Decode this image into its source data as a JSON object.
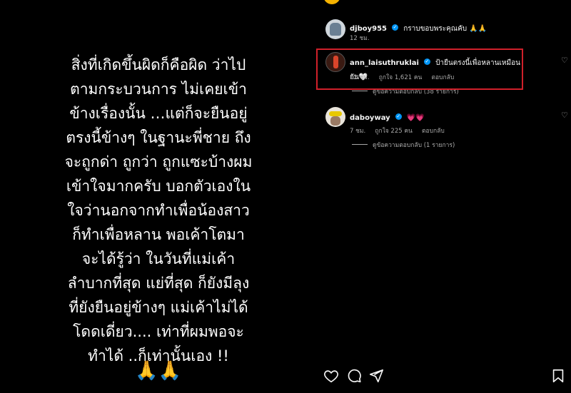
{
  "post": {
    "caption": "สิ่งที่เกิดขึ้นผิดก็คือผิด ว่าไป\nตามกระบวนการ ไม่เคยเข้า\nข้างเรื่องนั้น …แต่ก็จะยืนอยู่\nตรงนี้ข้างๆ ในฐานะพี่ชาย ถึง\nจะถูกด่า ถูกว่า ถูกแซะบ้างผม\nเข้าใจมากครับ บอกตัวเองใน\nใจว่านอกจากทำเพื่อน้องสาว\nก็ทำเพื่อหลาน พอเค้าโตมา\nจะได้รู้ว่า ในวันที่แม่เค้า\nลำบากที่สุด แย่ที่สุด ก็ยังมีลุง\nที่ยังยืนอยู่ข้างๆ แม่เค้าไม่ได้\nโดดเดี่ยว.... เท่าที่ผมพอจะ\nทำได้ ..ก็เท่านั้นเอง !!",
    "emoji": "🙏🙏"
  },
  "comments": [
    {
      "username": "djboy955",
      "text": "กราบขอบพระคุณคับ 🙏🙏",
      "time": "12 ชม."
    },
    {
      "username": "ann_laisuthruklai",
      "text": "ป้ายืนตรงนี้เพื่อหลานเหมือนกัน🤍",
      "time": "12 ชม.",
      "likes": "ถูกใจ 1,621 คน",
      "reply": "ตอบกลับ",
      "view_replies": "ดูข้อความตอบกลับ (38 รายการ)"
    },
    {
      "username": "daboyway",
      "text": "💗💗",
      "time": "7 ชม.",
      "likes": "ถูกใจ 225 คน",
      "reply": "ตอบกลับ",
      "view_replies": "ดูข้อความตอบกลับ (1 รายการ)"
    }
  ],
  "icons": {
    "like": "heart-icon",
    "comment": "comment-icon",
    "share": "share-icon",
    "save": "bookmark-icon",
    "verified": "verified-badge-icon"
  },
  "colors": {
    "highlight": "#d0202a",
    "verified": "#0095f6"
  }
}
